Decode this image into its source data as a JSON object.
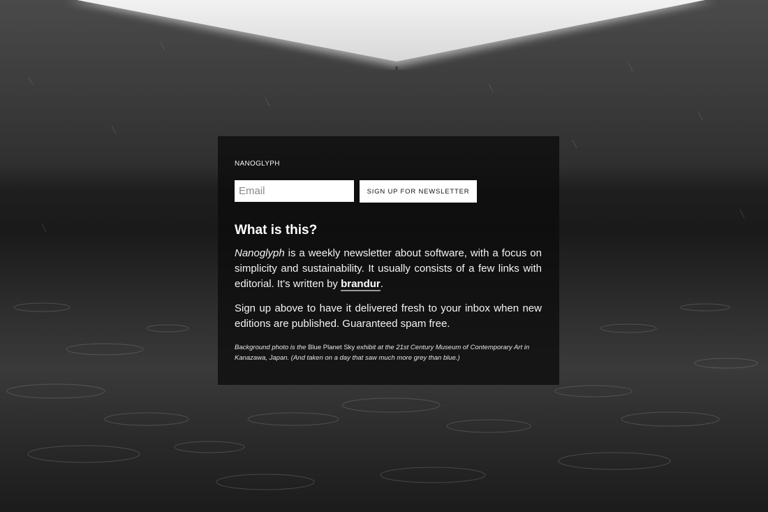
{
  "colors": {
    "panel_background": "#0c0c0c",
    "text": "#ffffff",
    "button_background": "#ffffff",
    "button_text": "#111111"
  },
  "brand": {
    "name": "NANOGLYPH"
  },
  "signup": {
    "email_placeholder": "Email",
    "email_value": "",
    "button_label": "SIGN UP FOR NEWSLETTER"
  },
  "about": {
    "heading": "What is this?",
    "intro_name": "Nanoglyph",
    "intro_text": " is a weekly newsletter about software, with a focus on simplicity and sustainability. It usually consists of a few links with editorial. It's written by ",
    "author": "brandur",
    "intro_end": ".",
    "signup_text": "Sign up above to have it delivered fresh to your inbox when new editions are published. Guaranteed spam free."
  },
  "credit": {
    "part1": "Background photo is the ",
    "exhibit": "Blue Planet Sky",
    "part2": " exhibit at the 21st Century Museum of Contemporary Art in Kanazawa, Japan. (And taken on a day that saw much more grey than blue.)"
  }
}
